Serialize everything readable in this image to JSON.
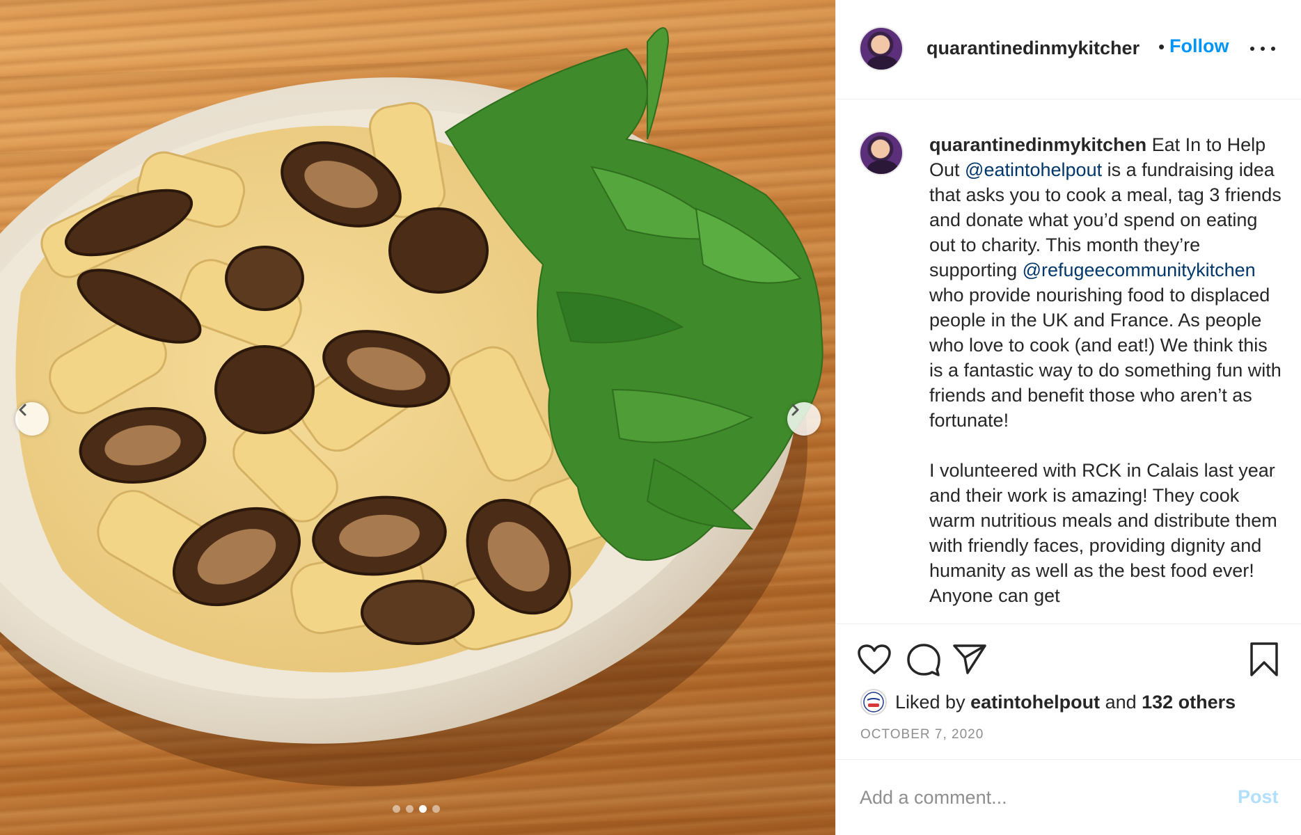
{
  "post": {
    "username": "quarantinedinmykitchen",
    "username_truncated": "quarantinedinmykitcher",
    "separator": "•",
    "follow_label": "Follow",
    "caption": {
      "username": "quarantinedinmykitchen",
      "p1_a": " Eat In to Help Out ",
      "mention_1": "@eatintohelpout",
      "p1_b": " is a fundraising idea that asks you to cook a meal, tag 3 friends and donate what you’d spend on eating out to charity. This month they’re supporting ",
      "mention_2": "@refugeecommunitykitchen",
      "p1_c": " who provide nourishing food to displaced people in the UK and France. As people who love to cook (and eat!) We think this is a fantastic way to do something fun with friends and benefit those who aren’t as fortunate!",
      "p2": "I volunteered with RCK in Calais last year and their work is amazing! They cook warm nutritious meals and distribute them with friendly faces, providing dignity and humanity as well as the best food ever! Anyone can get"
    },
    "likes": {
      "prefix": "Liked by ",
      "liker": "eatintohelpout",
      "middle": " and ",
      "others": "132 others",
      "liker_avatar_text": "Eat In"
    },
    "date": "OCTOBER 7, 2020",
    "comment": {
      "placeholder": "Add a comment...",
      "post_label": "Post"
    },
    "carousel": {
      "total_slides": 4,
      "active_slide": 3
    }
  },
  "icons": {
    "like": "heart-icon",
    "comment": "speech-bubble-icon",
    "share": "paper-plane-icon",
    "save": "bookmark-icon",
    "more": "more-dots-icon",
    "prev": "chevron-left-icon",
    "next": "chevron-right-icon"
  },
  "colors": {
    "link_blue": "#0095f6",
    "mention_blue": "#00376b",
    "post_disabled": "#b2dffc",
    "muted": "#8e8e8e"
  }
}
